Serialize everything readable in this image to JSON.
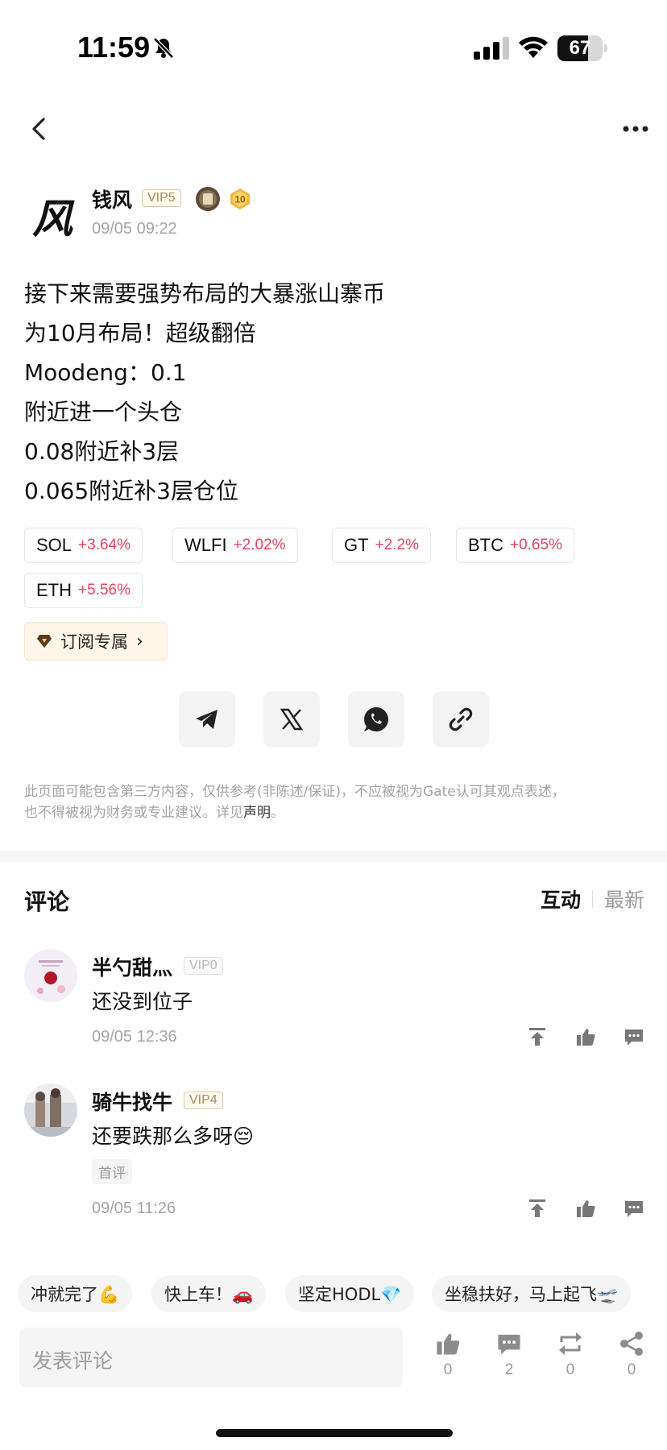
{
  "status_bar": {
    "time": "11:59",
    "battery": "67",
    "battery_level": 0.67
  },
  "author": {
    "avatar_char": "风",
    "name": "钱风",
    "vip": "VIP5",
    "medal_level": "10",
    "timestamp": "09/05 09:22"
  },
  "post": {
    "lines": [
      "接下来需要强势布局的大暴涨山寨币",
      "为10月布局！超级翻倍",
      "Moodeng：0.1",
      "附近进一个头仓",
      "0.08附近补3层",
      "0.065附近补3层仓位"
    ]
  },
  "tickers": [
    {
      "symbol": "SOL",
      "change": "+3.64%"
    },
    {
      "symbol": "WLFI",
      "change": "+2.02%"
    },
    {
      "symbol": "GT",
      "change": "+2.2%"
    },
    {
      "symbol": "BTC",
      "change": "+0.65%"
    },
    {
      "symbol": "ETH",
      "change": "+5.56%"
    }
  ],
  "subscribe": {
    "label": "订阅专属"
  },
  "share": {
    "icons": [
      "telegram-icon",
      "x-icon",
      "whatsapp-icon",
      "link-icon"
    ]
  },
  "disclaimer": {
    "line1": "此页面可能包含第三方内容，仅供参考(非陈述/保证)，不应被视为Gate认可其观点表述，",
    "line2_prefix": "也不得被视为财务或专业建议。详见",
    "link": "声明",
    "suffix": "。"
  },
  "comments_section": {
    "title": "评论",
    "sort_active": "互动",
    "sort_inactive": "最新",
    "items": [
      {
        "name": "半勺甜灬",
        "vip": "VIP0",
        "text": "还没到位子",
        "time": "09/05 12:36",
        "tag": ""
      },
      {
        "name": "骑牛找牛",
        "vip": "VIP4",
        "text": "还要跌那么多呀😔",
        "time": "09/05 11:26",
        "tag": "首评"
      }
    ]
  },
  "quick_replies": [
    "冲就完了💪",
    "快上车！🚗",
    "坚定HODL💎",
    "坐稳扶好，马上起飞🛫"
  ],
  "composer": {
    "placeholder": "发表评论"
  },
  "bottom_actions": {
    "like_count": "0",
    "comment_count": "2",
    "repost_count": "0",
    "share_count": "0"
  },
  "colors": {
    "up": "#e0465e",
    "vip_border": "#d9c7a6",
    "subscribe_bg": "#fff5e8"
  }
}
